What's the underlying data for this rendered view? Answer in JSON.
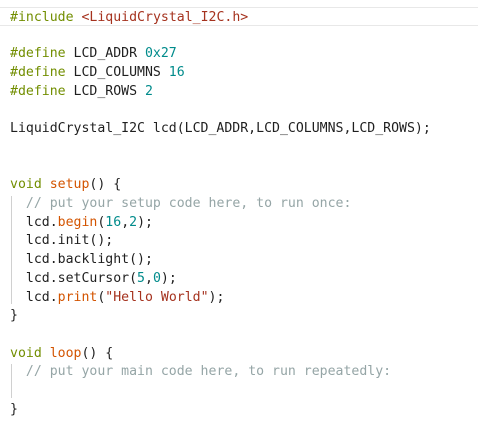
{
  "editor": {
    "lines": [
      {
        "parts": [
          {
            "t": "#include",
            "c": "kw"
          },
          {
            "t": " ",
            "c": "plain"
          },
          {
            "t": "<LiquidCrystal_I2C.h>",
            "c": "str"
          }
        ]
      },
      {
        "parts": []
      },
      {
        "parts": [
          {
            "t": "#define",
            "c": "kw"
          },
          {
            "t": " LCD_ADDR ",
            "c": "plain"
          },
          {
            "t": "0x27",
            "c": "num"
          }
        ]
      },
      {
        "parts": [
          {
            "t": "#define",
            "c": "kw"
          },
          {
            "t": " LCD_COLUMNS ",
            "c": "plain"
          },
          {
            "t": "16",
            "c": "num"
          }
        ]
      },
      {
        "parts": [
          {
            "t": "#define",
            "c": "kw"
          },
          {
            "t": " LCD_ROWS ",
            "c": "plain"
          },
          {
            "t": "2",
            "c": "num"
          }
        ]
      },
      {
        "parts": []
      },
      {
        "parts": [
          {
            "t": "LiquidCrystal_I2C lcd(LCD_ADDR,LCD_COLUMNS,LCD_ROWS);",
            "c": "plain"
          }
        ]
      },
      {
        "parts": []
      },
      {
        "parts": []
      },
      {
        "parts": [
          {
            "t": "void",
            "c": "kw"
          },
          {
            "t": " ",
            "c": "plain"
          },
          {
            "t": "setup",
            "c": "fn-orange"
          },
          {
            "t": "() {",
            "c": "plain"
          }
        ]
      },
      {
        "parts": [
          {
            "t": "  ",
            "c": "plain"
          },
          {
            "t": "// put your setup code here, to run once:",
            "c": "cmt"
          }
        ]
      },
      {
        "parts": [
          {
            "t": "  lcd.",
            "c": "plain"
          },
          {
            "t": "begin",
            "c": "fn-method"
          },
          {
            "t": "(",
            "c": "plain"
          },
          {
            "t": "16",
            "c": "num"
          },
          {
            "t": ",",
            "c": "plain"
          },
          {
            "t": "2",
            "c": "num"
          },
          {
            "t": ");",
            "c": "plain"
          }
        ]
      },
      {
        "parts": [
          {
            "t": "  lcd.init();",
            "c": "plain"
          }
        ]
      },
      {
        "parts": [
          {
            "t": "  lcd.backlight();",
            "c": "plain"
          }
        ]
      },
      {
        "parts": [
          {
            "t": "  lcd.setCursor(",
            "c": "plain"
          },
          {
            "t": "5",
            "c": "num"
          },
          {
            "t": ",",
            "c": "plain"
          },
          {
            "t": "0",
            "c": "num"
          },
          {
            "t": ");",
            "c": "plain"
          }
        ]
      },
      {
        "parts": [
          {
            "t": "  lcd.",
            "c": "plain"
          },
          {
            "t": "print",
            "c": "fn-method"
          },
          {
            "t": "(",
            "c": "plain"
          },
          {
            "t": "\"Hello World\"",
            "c": "str"
          },
          {
            "t": ");",
            "c": "plain"
          }
        ]
      },
      {
        "parts": [
          {
            "t": "}",
            "c": "plain"
          }
        ]
      },
      {
        "parts": []
      },
      {
        "parts": [
          {
            "t": "void",
            "c": "kw"
          },
          {
            "t": " ",
            "c": "plain"
          },
          {
            "t": "loop",
            "c": "fn-orange"
          },
          {
            "t": "() {",
            "c": "plain"
          }
        ]
      },
      {
        "parts": [
          {
            "t": "  ",
            "c": "plain"
          },
          {
            "t": "// put your main code here, to run repeatedly:",
            "c": "cmt"
          }
        ]
      },
      {
        "parts": []
      },
      {
        "parts": [
          {
            "t": "}",
            "c": "plain"
          }
        ]
      }
    ]
  }
}
